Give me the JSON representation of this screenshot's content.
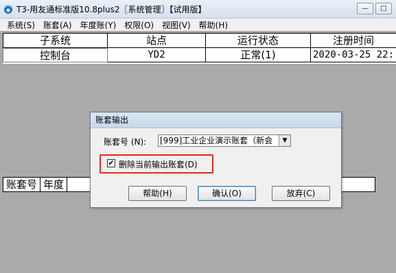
{
  "window": {
    "title": "T3-用友通标准版10.8plus2〖系统管理〗【试用版】",
    "minimize_glyph": "—",
    "maximize_glyph": "□"
  },
  "menu": [
    "系统(S)",
    "账套(A)",
    "年度账(Y)",
    "权限(O)",
    "视图(V)",
    "帮助(H)"
  ],
  "subsystem_table": {
    "headers": [
      "子系统",
      "站点",
      "运行状态",
      "注册时间"
    ],
    "rows": [
      [
        "控制台",
        "YD2",
        "正常(1)",
        "2020-03-25 22:"
      ]
    ]
  },
  "account_table": {
    "headers": [
      "账套号",
      "年度"
    ]
  },
  "dialog": {
    "title": "账套输出",
    "account_label": "账套号 (N):",
    "account_value": "[999]工业企业演示账套（新会",
    "delete_checked": true,
    "delete_label": "删除当前输出账套(D)",
    "help_button": "帮助(H)",
    "confirm_button": "确认(O)",
    "cancel_button": "放弃(C)"
  },
  "colors": {
    "workspace": "#aaaaaa",
    "highlight_border": "#e8261f"
  }
}
